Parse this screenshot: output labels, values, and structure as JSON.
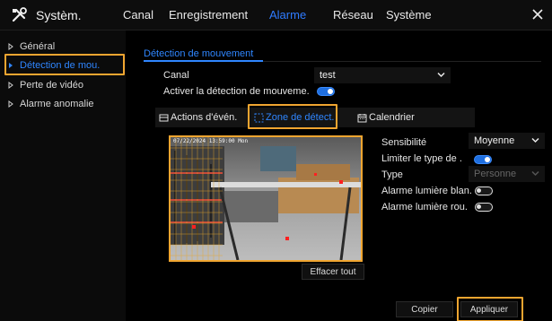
{
  "app": {
    "title": "Systèm."
  },
  "nav": {
    "tabs": [
      {
        "label": "Canal"
      },
      {
        "label": "Enregistrement"
      },
      {
        "label": "Alarme"
      },
      {
        "label": "Réseau"
      },
      {
        "label": "Système"
      }
    ],
    "active_tab": "Alarme"
  },
  "sidebar": {
    "items": [
      {
        "label": "Général"
      },
      {
        "label": "Détection de mou."
      },
      {
        "label": "Perte de vidéo"
      },
      {
        "label": "Alarme anomalie"
      }
    ],
    "active_item": "Détection de mou."
  },
  "section": {
    "title": "Détection de mouvement"
  },
  "form": {
    "canal_label": "Canal",
    "canal_value": "test",
    "enable_label": "Activer la détection de mouveme.",
    "enable_on": true
  },
  "subtabs": [
    {
      "label": "Actions d'évén."
    },
    {
      "label": "Zone de détect."
    },
    {
      "label": "Calendrier"
    }
  ],
  "active_subtab": "Zone de détect.",
  "video": {
    "timestamp": "07/22/2024 13:59:00 Mon"
  },
  "settings": {
    "sensitivity_label": "Sensibilité",
    "sensitivity_value": "Moyenne",
    "limit_label": "Limiter le type de .",
    "limit_on": true,
    "type_label": "Type",
    "type_value": "Personne",
    "white_light_label": "Alarme lumière blan.",
    "white_light_on": false,
    "red_light_label": "Alarme lumière rou.",
    "red_light_on": false
  },
  "buttons": {
    "clear_all": "Effacer tout",
    "copy": "Copier",
    "apply": "Appliquer"
  },
  "colors": {
    "accent": "#2f86ff",
    "highlight": "#f0a530",
    "grid": "#e8a72a"
  }
}
